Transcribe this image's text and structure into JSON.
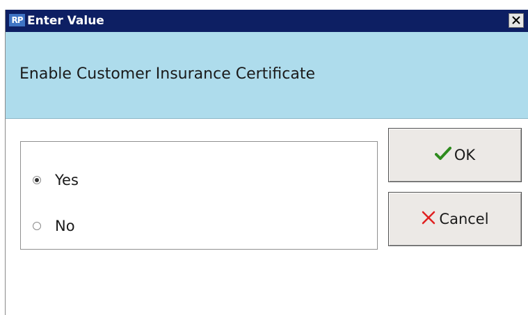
{
  "window": {
    "title": "Enter Value",
    "app_icon_text": "RP",
    "close_icon": "close-icon"
  },
  "prompt": {
    "label": "Enable Customer Insurance Certificate"
  },
  "options": [
    {
      "label": "Yes",
      "selected": true
    },
    {
      "label": "No",
      "selected": false
    }
  ],
  "buttons": {
    "ok_label": "OK",
    "ok_icon": "checkmark-icon",
    "cancel_label": "Cancel",
    "cancel_icon": "x-icon"
  },
  "colors": {
    "titlebar": "#0d1f63",
    "header_band": "#aedcec",
    "ok_check": "#2e8b1e",
    "cancel_x": "#e02020"
  }
}
